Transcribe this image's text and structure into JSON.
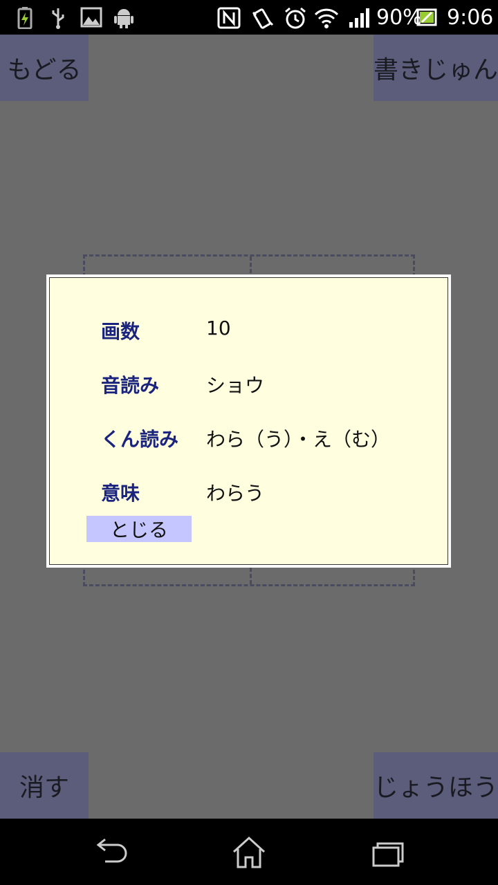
{
  "status_bar": {
    "battery_percent": "90%",
    "time": "9:06",
    "icons": [
      "battery-charging-icon",
      "usb-icon",
      "image-icon",
      "android-icon",
      "nfc-icon",
      "vibrate-icon",
      "alarm-icon",
      "wifi-icon",
      "signal-icon",
      "battery-icon"
    ]
  },
  "buttons": {
    "back": "もどる",
    "stroke_order": "書きじゅん",
    "erase": "消す",
    "info": "じょうほう"
  },
  "dialog": {
    "rows": [
      {
        "label": "画数",
        "value": "10"
      },
      {
        "label": "音読み",
        "value": "ショウ"
      },
      {
        "label": "くん読み",
        "value": "わら（う）・え（む）"
      },
      {
        "label": "意味",
        "value": "わらう"
      }
    ],
    "close_label": "とじる"
  },
  "navigation": [
    "back-icon",
    "home-icon",
    "recent-apps-icon"
  ]
}
